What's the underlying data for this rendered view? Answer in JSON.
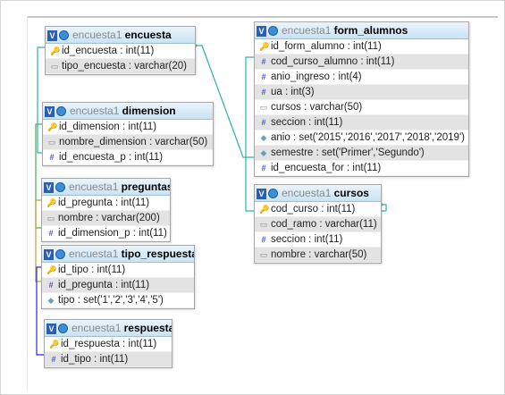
{
  "tables": {
    "encuesta": {
      "db": "encuesta1",
      "name": "encuesta",
      "fields": [
        {
          "icon": "key-icon",
          "text": "id_encuesta : int(11)"
        },
        {
          "icon": "text-field-icon",
          "text": "tipo_encuesta : varchar(20)"
        }
      ]
    },
    "dimension": {
      "db": "encuesta1",
      "name": "dimension",
      "fields": [
        {
          "icon": "key-icon",
          "text": "id_dimension : int(11)"
        },
        {
          "icon": "text-field-icon",
          "text": "nombre_dimension : varchar(50)"
        },
        {
          "icon": "numeric-field-icon",
          "text": "id_encuesta_p : int(11)"
        }
      ]
    },
    "preguntas": {
      "db": "encuesta1",
      "name": "preguntas",
      "fields": [
        {
          "icon": "key-icon",
          "text": "id_pregunta : int(11)"
        },
        {
          "icon": "text-field-icon",
          "text": "nombre : varchar(200)"
        },
        {
          "icon": "numeric-field-icon",
          "text": "id_dimension_p : int(11)"
        }
      ]
    },
    "tipo_respuesta": {
      "db": "encuesta1",
      "name": "tipo_respuesta",
      "fields": [
        {
          "icon": "key-icon",
          "text": "id_tipo : int(11)"
        },
        {
          "icon": "numeric-field-icon",
          "text": "id_pregunta : int(11)"
        },
        {
          "icon": "set-field-icon",
          "text": "tipo : set('1','2','3','4','5')"
        }
      ]
    },
    "respuesta": {
      "db": "encuesta1",
      "name": "respuesta",
      "fields": [
        {
          "icon": "key-icon",
          "text": "id_respuesta : int(11)"
        },
        {
          "icon": "numeric-field-icon",
          "text": "id_tipo : int(11)"
        }
      ]
    },
    "form_alumnos": {
      "db": "encuesta1",
      "name": "form_alumnos",
      "fields": [
        {
          "icon": "key-icon",
          "text": "id_form_alumno : int(11)"
        },
        {
          "icon": "numeric-field-icon",
          "text": "cod_curso_alumno : int(11)"
        },
        {
          "icon": "numeric-field-icon",
          "text": "anio_ingreso : int(4)"
        },
        {
          "icon": "numeric-field-icon",
          "text": "ua : int(3)"
        },
        {
          "icon": "text-field-icon",
          "text": "cursos : varchar(50)"
        },
        {
          "icon": "numeric-field-icon",
          "text": "seccion : int(11)"
        },
        {
          "icon": "set-field-icon",
          "text": "anio : set('2015','2016','2017','2018','2019')"
        },
        {
          "icon": "set-field-icon",
          "text": "semestre : set('Primer','Segundo')"
        },
        {
          "icon": "numeric-field-icon",
          "text": "id_encuesta_for : int(11)"
        }
      ]
    },
    "cursos": {
      "db": "encuesta1",
      "name": "cursos",
      "fields": [
        {
          "icon": "key-icon",
          "text": "cod_curso : int(11)"
        },
        {
          "icon": "text-field-icon",
          "text": "cod_ramo : varchar(11)"
        },
        {
          "icon": "numeric-field-icon",
          "text": "seccion : int(11)"
        },
        {
          "icon": "text-field-icon",
          "text": "nombre : varchar(50)"
        }
      ]
    }
  },
  "header_icons": {
    "toggle": "V",
    "gear": "gear-icon"
  },
  "relation_colors": [
    "#2bb5a6",
    "#2bb5a6",
    "#4cab5a",
    "#b5a62b",
    "#2b2bd4",
    "#2bb5a6"
  ]
}
